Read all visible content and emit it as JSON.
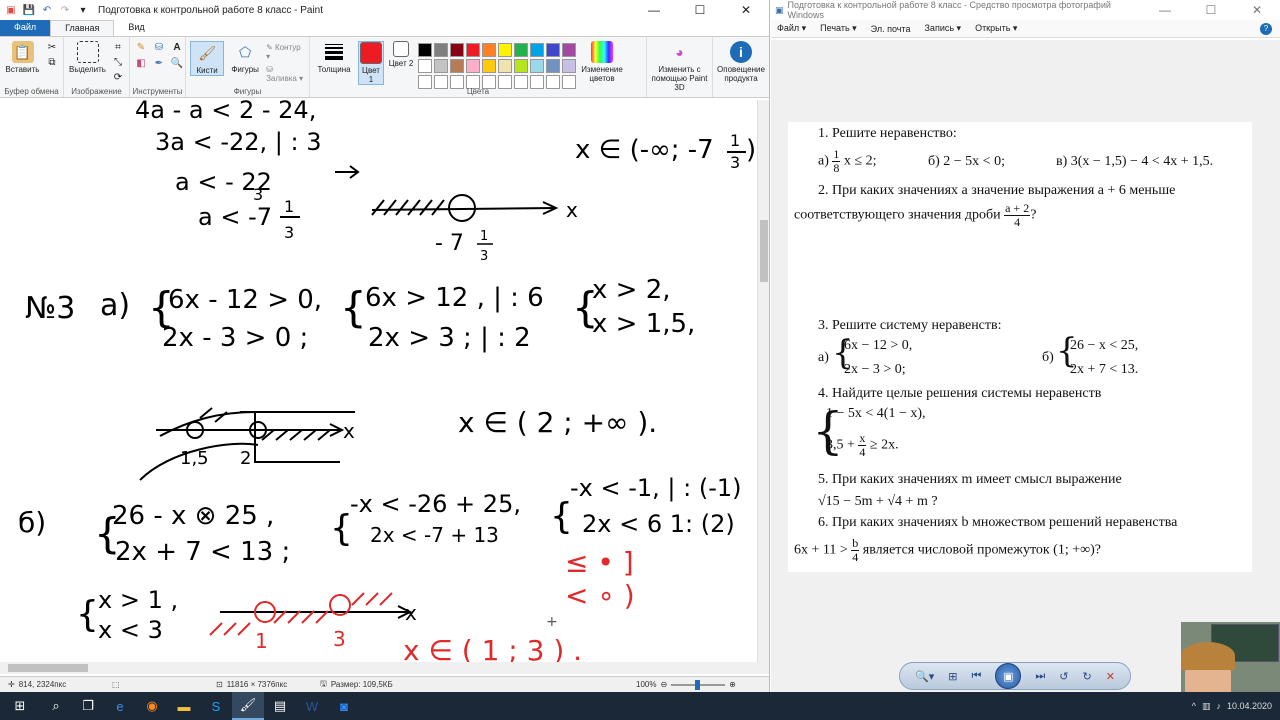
{
  "paint": {
    "title": "Подготовка к контрольной работе 8 класс - Paint",
    "tabs": {
      "file": "Файл",
      "home": "Главная",
      "view": "Вид"
    },
    "ribbon": {
      "paste": "Вставить",
      "select": "Выделить",
      "brushes": "Кисти",
      "shapes": "Фигуры",
      "outline": "Контур",
      "fill": "Заливка",
      "thickness": "Толщина",
      "color1": "Цвет 1",
      "color2": "Цвет 2",
      "edit_colors": "Изменение цветов",
      "paint3d": "Изменить с помощью Paint 3D",
      "product_alert": "Оповещение продукта",
      "groups": {
        "clipboard": "Буфер обмена",
        "image": "Изображение",
        "tools": "Инструменты",
        "shapes": "Фигуры",
        "colors": "Цвета"
      },
      "palette": [
        "#000000",
        "#7f7f7f",
        "#880015",
        "#ed1c24",
        "#ff7f27",
        "#fff200",
        "#22b14c",
        "#00a2e8",
        "#3f48cc",
        "#a349a4",
        "#ffffff",
        "#c3c3c3",
        "#b97a57",
        "#ffaec9",
        "#ffc90e",
        "#efe4b0",
        "#b5e61d",
        "#99d9ea",
        "#7092be",
        "#c8bfe7",
        "#ffffff",
        "#ffffff",
        "#ffffff",
        "#ffffff",
        "#ffffff",
        "#ffffff",
        "#ffffff",
        "#ffffff",
        "#ffffff",
        "#ffffff"
      ],
      "color1_value": "#ed1c24",
      "color2_value": "#ffffff"
    },
    "status": {
      "cursor": "814, 2324пкс",
      "canvas_size": "11816 × 7376пкс",
      "file_size": "Размер: 109,5КБ",
      "zoom": "100%"
    },
    "handwriting": {
      "l1": "4a - a < 2 - 24,",
      "l2": "3a < -22, | : 3",
      "l3": "a < - 22",
      "l3d": "3",
      "l4": "a < -7",
      "l4n": "1",
      "l4d": "3",
      "ans1": "x ∈ (-∞; -7",
      "ans1n": "1",
      "ans1d": "3",
      "ans1c": ")",
      "axis1x": "x",
      "axis1val": "- 7",
      "axis1n": "1",
      "axis1d": "3",
      "n3": "№3",
      "n3a": "а)",
      "s1a": "6x - 12 > 0,",
      "s1b": "2x - 3 > 0 ;",
      "s2a": "6x  > 12 , | : 6",
      "s2b": "2x  > 3 ; | : 2",
      "s3a": "x > 2,",
      "s3b": "x > 1,5,",
      "ax2v1": "1,5",
      "ax2v2": "2",
      "ax2x": "x",
      "ans2": "x ∈ ( 2 ; +∞ ).",
      "b": "б)",
      "b1a": "26 - x ⊗ 25 ,",
      "b1b": "2x + 7 < 13 ;",
      "b2a": "-x < -26 + 25,",
      "b2b": "2x < -7 + 13",
      "b3a": "-x < -1, | : (-1)",
      "b3b": "2x < 6   1: (2)",
      "c1": "x > 1 ,",
      "c2": "x < 3",
      "ax3v1": "1",
      "ax3v2": "3",
      "ax3x": "x",
      "ans3": "x ∈ ( 1 ; 3 ) .",
      "red1": "≤ • ]",
      "red2": "< ∘ )"
    }
  },
  "viewer": {
    "title": "Подготовка к контрольной работе 8 класс - Средство просмотра фотографий Windows",
    "menu": [
      "Файл ▾",
      "Печать ▾",
      "Эл. почта",
      "Запись ▾",
      "Открыть ▾"
    ],
    "doc": {
      "q1": "1. Решите неравенство:",
      "q1a_pre": "а)",
      "q1a_n": "1",
      "q1a_d": "8",
      "q1a_post": "x ≤ 2;",
      "q1b": "б) 2 − 5x < 0;",
      "q1c": "в) 3(x − 1,5) − 4 < 4x + 1,5.",
      "q2a": "2. При каких значениях a значение выражения a + 6 меньше",
      "q2b": "соответствующего значения дроби",
      "q2n": "a + 2",
      "q2d": "4",
      "q2q": "?",
      "q3": "3. Решите систему неравенств:",
      "q3a": "а)",
      "q3a1": "6x − 12 > 0,",
      "q3a2": "2x − 3 > 0;",
      "q3b": "б)",
      "q3b1": "26 − x < 25,",
      "q3b2": "2x + 7 < 13.",
      "q4": "4. Найдите целые решения системы неравенств",
      "q4a": "1 − 5x < 4(1 − x),",
      "q4b_pre": "3,5 +",
      "q4b_n": "x",
      "q4b_d": "4",
      "q4b_post": "≥ 2x.",
      "q5": "5. При каких значениях m имеет смысл выражение",
      "q5e": "√15 − 5m + √4 + m ?",
      "q6": "6. При каких значениях b множеством решений неравенства",
      "q6pre": "6x + 11 >",
      "q6n": "b",
      "q6d": "4",
      "q6post": "является числовой промежуток (1; +∞)?"
    }
  },
  "taskbar": {
    "time": "10.04.2020"
  }
}
